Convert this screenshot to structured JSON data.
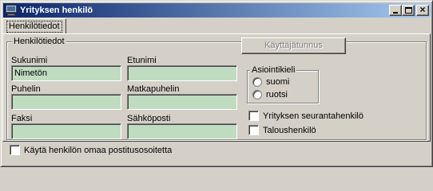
{
  "window": {
    "title": "Yrityksen henkilö",
    "icon": "app-window-icon",
    "title_gradient": [
      "#0a246a",
      "#a6caf0"
    ]
  },
  "tabs": [
    {
      "label": "Henkilötiedot",
      "active": true
    }
  ],
  "person_group": {
    "legend": "Henkilötiedot",
    "fields": {
      "lastname": {
        "label": "Sukunimi",
        "value": "Nimetön"
      },
      "firstname": {
        "label": "Etunimi",
        "value": ""
      },
      "phone": {
        "label": "Puhelin",
        "value": ""
      },
      "mobile": {
        "label": "Matkapuhelin",
        "value": ""
      },
      "fax": {
        "label": "Faksi",
        "value": ""
      },
      "email": {
        "label": "Sähköposti",
        "value": ""
      }
    },
    "username_button": {
      "label": "Käyttäjätunnus",
      "enabled": false
    },
    "language_group": {
      "legend": "Asiointikieli",
      "options": [
        "suomi",
        "ruotsi"
      ],
      "selected": null
    },
    "company_tracking_person": {
      "label": "Yrityksen seurantahenkilö",
      "checked": false
    },
    "finance_person": {
      "label": "Taloushenkilö",
      "checked": false
    }
  },
  "use_own_postal_address": {
    "label": "Käytä henkilön omaa postitusosoitetta",
    "checked": false
  },
  "colors": {
    "field_background": "#c0dcc0",
    "face": "#d4d0c8"
  }
}
